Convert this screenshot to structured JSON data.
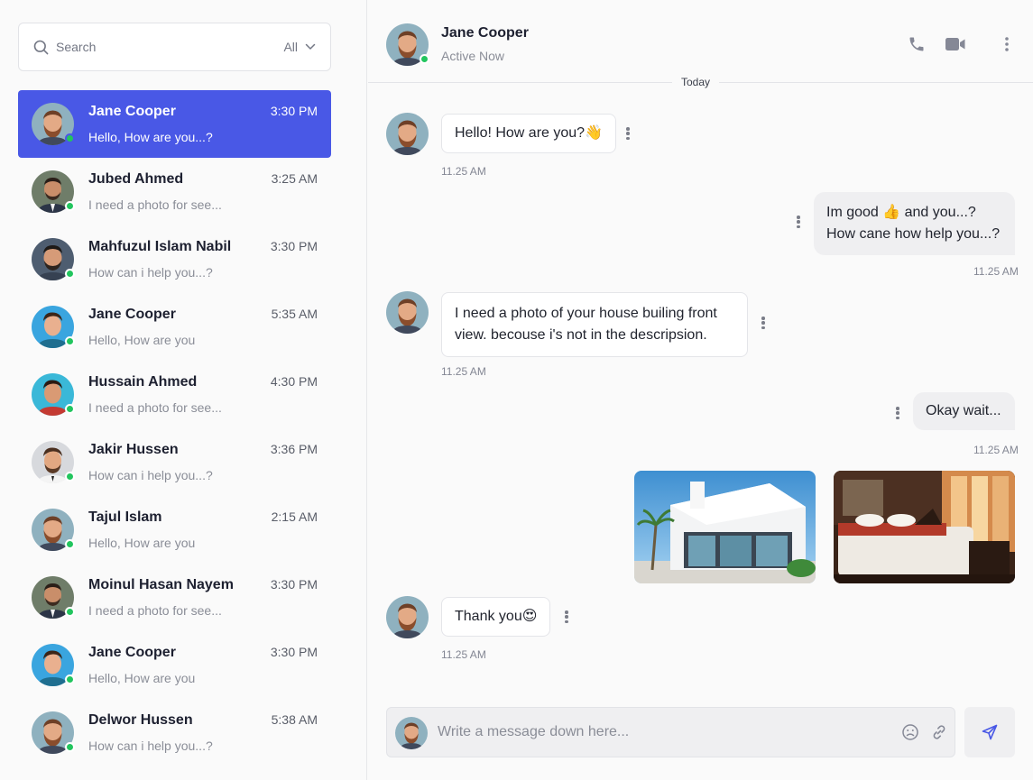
{
  "search": {
    "placeholder": "Search",
    "filter_label": "All"
  },
  "conversations": [
    {
      "name": "Jane Cooper",
      "time": "3:30 PM",
      "preview": "Hello, How are you...?",
      "active": true,
      "online": true
    },
    {
      "name": "Jubed Ahmed",
      "time": "3:25 AM",
      "preview": "I need a photo for see...",
      "online": true
    },
    {
      "name": "Mahfuzul Islam Nabil",
      "time": "3:30 PM",
      "preview": "How can i help you...?",
      "online": true
    },
    {
      "name": "Jane Cooper",
      "time": "5:35 AM",
      "preview": "Hello, How are you",
      "online": true
    },
    {
      "name": "Hussain Ahmed",
      "time": "4:30 PM",
      "preview": "I need a photo for see...",
      "online": true
    },
    {
      "name": "Jakir Hussen",
      "time": "3:36 PM",
      "preview": "How can i help you...?",
      "online": true
    },
    {
      "name": "Tajul Islam",
      "time": "2:15 AM",
      "preview": "Hello, How are you",
      "online": true
    },
    {
      "name": "Moinul Hasan Nayem",
      "time": "3:30 PM",
      "preview": "I need a photo for see...",
      "online": true
    },
    {
      "name": "Jane Cooper",
      "time": "3:30 PM",
      "preview": "Hello, How are you",
      "online": true
    },
    {
      "name": "Delwor Hussen",
      "time": "5:38 AM",
      "preview": "How can i help you...?",
      "online": true
    }
  ],
  "chat_header": {
    "name": "Jane Cooper",
    "status": "Active Now"
  },
  "day_divider": "Today",
  "messages": [
    {
      "direction": "in",
      "text": "Hello! How are you?👋",
      "time": "11.25 AM"
    },
    {
      "direction": "out",
      "lines": [
        "Im good 👍 and you...?",
        "How cane how help you...?"
      ],
      "time": "11.25 AM"
    },
    {
      "direction": "in",
      "lines": [
        "I need a photo of your house builing front",
        "view. becouse i's not in the descripsion."
      ],
      "time": "11.25 AM"
    },
    {
      "direction": "out",
      "text": "Okay wait...",
      "time": "11.25 AM"
    },
    {
      "direction": "out",
      "type": "images",
      "images": [
        "house-exterior-photo",
        "bedroom-interior-photo"
      ]
    },
    {
      "direction": "in",
      "text": "Thank you😍",
      "time": "11.25 AM"
    }
  ],
  "composer": {
    "placeholder": "Write a message down here..."
  },
  "colors": {
    "accent": "#4958e6",
    "online": "#22c55e",
    "background": "#fafafa"
  },
  "icons": [
    "search-icon",
    "chevron-down-icon",
    "phone-icon",
    "video-icon",
    "more-vertical-icon",
    "emoji-icon",
    "link-icon",
    "send-icon"
  ]
}
